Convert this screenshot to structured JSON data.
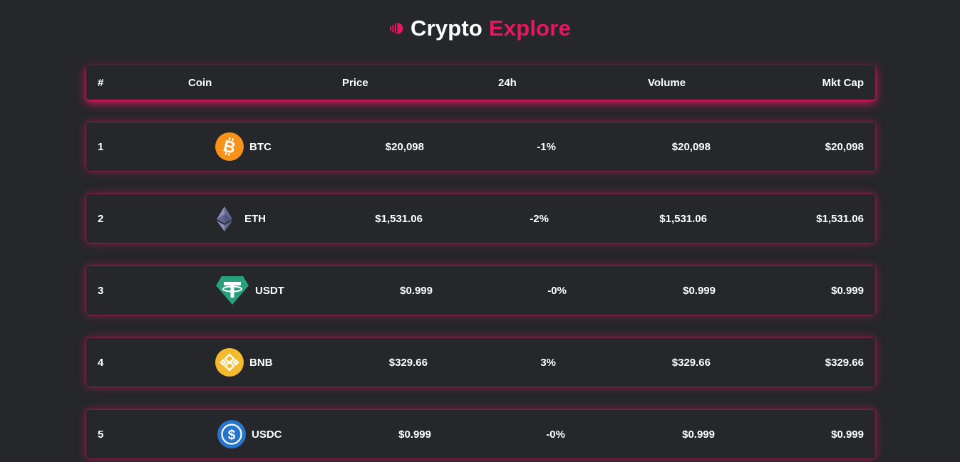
{
  "brand": {
    "title_part1": "Crypto",
    "title_part2": "Explore",
    "accent_color": "#e8175d"
  },
  "table": {
    "headers": {
      "rank": "#",
      "coin": "Coin",
      "price": "Price",
      "change": "24h",
      "volume": "Volume",
      "mkt_cap": "Mkt Cap"
    },
    "rows": [
      {
        "rank": "1",
        "symbol": "BTC",
        "icon": "bitcoin-icon",
        "price": "$20,098",
        "change": "-1%",
        "volume": "$20,098",
        "mkt_cap": "$20,098"
      },
      {
        "rank": "2",
        "symbol": "ETH",
        "icon": "ethereum-icon",
        "price": "$1,531.06",
        "change": "-2%",
        "volume": "$1,531.06",
        "mkt_cap": "$1,531.06"
      },
      {
        "rank": "3",
        "symbol": "USDT",
        "icon": "tether-icon",
        "price": "$0.999",
        "change": "-0%",
        "volume": "$0.999",
        "mkt_cap": "$0.999"
      },
      {
        "rank": "4",
        "symbol": "BNB",
        "icon": "bnb-icon",
        "price": "$329.66",
        "change": "3%",
        "volume": "$329.66",
        "mkt_cap": "$329.66"
      },
      {
        "rank": "5",
        "symbol": "USDC",
        "icon": "usd-coin-icon",
        "price": "$0.999",
        "change": "-0%",
        "volume": "$0.999",
        "mkt_cap": "$0.999"
      }
    ]
  }
}
